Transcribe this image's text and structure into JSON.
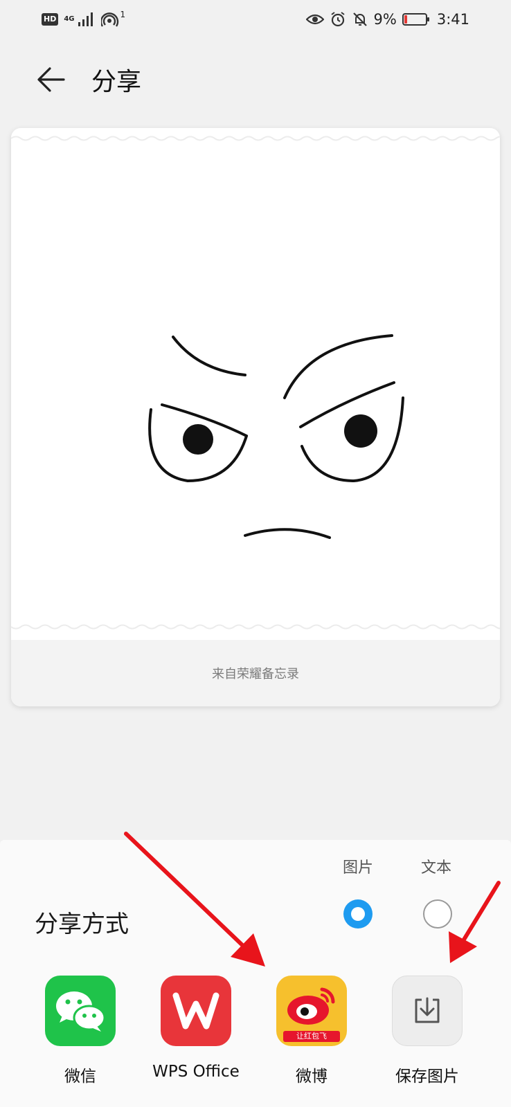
{
  "status_bar": {
    "hd_badge": "HD",
    "network": "4G",
    "hotspot_count": "1",
    "battery_percent": "9%",
    "time": "3:41"
  },
  "header": {
    "title": "分享"
  },
  "preview": {
    "footer_text": "来自荣耀备忘录"
  },
  "share_sheet": {
    "format_options": [
      {
        "label": "图片",
        "selected": true
      },
      {
        "label": "文本",
        "selected": false
      }
    ],
    "method_label": "分享方式",
    "apps": [
      {
        "label": "微信",
        "icon": "wechat-icon",
        "color": "#1fc34a"
      },
      {
        "label": "WPS Office",
        "icon": "wps-icon",
        "color": "#e8353a"
      },
      {
        "label": "微博",
        "icon": "weibo-icon",
        "color": "#f6c02d",
        "badge": "让红包飞"
      },
      {
        "label": "保存图片",
        "icon": "save-image-icon",
        "color": "#ededed"
      }
    ]
  },
  "colors": {
    "accent": "#1e9bf0",
    "annotation_arrow": "#e8141b"
  }
}
